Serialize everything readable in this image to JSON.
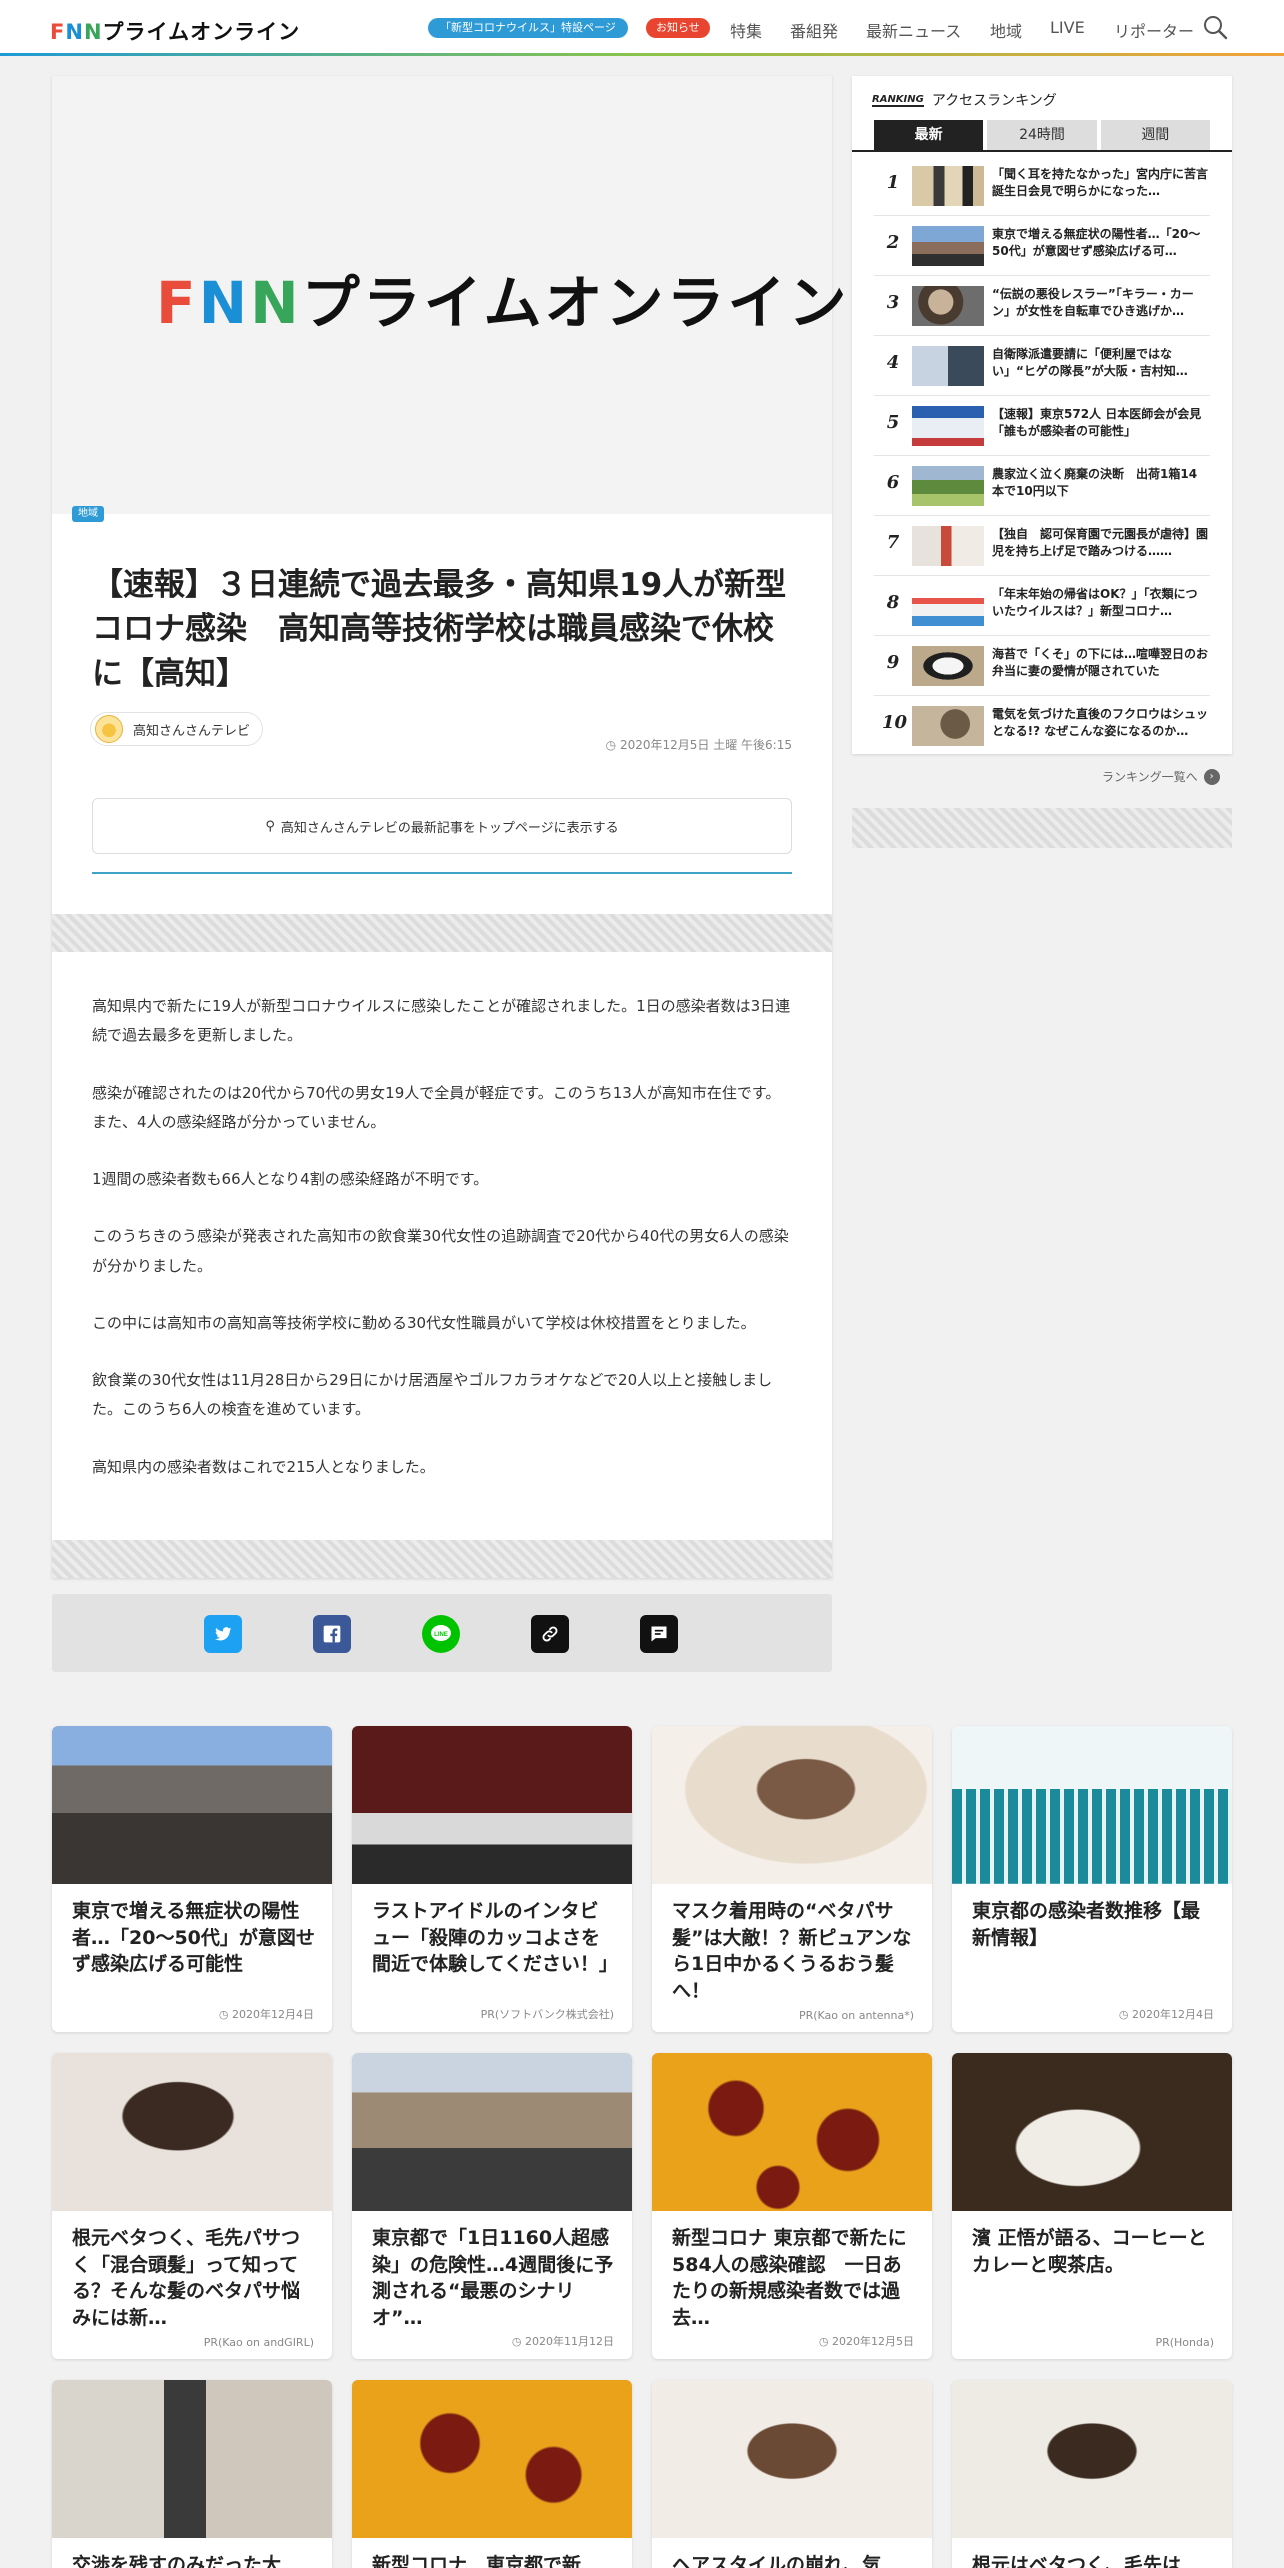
{
  "header": {
    "logo": "FNNプライムオンライン",
    "corona_pill": "「新型コロナウイルス」特設ページ",
    "notice_pill": "お知らせ",
    "nav": [
      "特集",
      "番組発",
      "最新ニュース",
      "地域",
      "LIVE",
      "リポーター"
    ]
  },
  "article": {
    "hero_logo": "FNNプライムオンライン",
    "category": "地域",
    "title": "【速報】３日連続で過去最多・高知県19人が新型コロナ感染　高知高等技術学校は職員感染で休校に【高知】",
    "source": "高知さんさんテレビ",
    "timestamp": "2020年12月5日 土曜 午後6:15",
    "follow_label": "高知さんさんテレビの最新記事をトップページに表示する",
    "paragraphs": [
      "高知県内で新たに19人が新型コロナウイルスに感染したことが確認されました。1日の感染者数は3日連続で過去最多を更新しました。",
      "感染が確認されたのは20代から70代の男女19人で全員が軽症です。このうち13人が高知市在住です。また、4人の感染経路が分かっていません。",
      "1週間の感染者数も66人となり4割の感染経路が不明です。",
      "このうちきのう感染が発表された高知市の飲食業30代女性の追跡調査で20代から40代の男女6人の感染が分かりました。",
      "この中には高知市の高知高等技術学校に勤める30代女性職員がいて学校は休校措置をとりました。",
      "飲食業の30代女性は11月28日から29日にかけ居酒屋やゴルフカラオケなどで20人以上と接触しました。このうち6人の検査を進めています。",
      "高知県内の感染者数はこれで215人となりました。"
    ]
  },
  "share": {
    "buttons": [
      {
        "name": "twitter",
        "color": "#1da1f2",
        "glyph": "t"
      },
      {
        "name": "facebook",
        "color": "#3b5998",
        "glyph": "f"
      },
      {
        "name": "line",
        "color": "#00c300",
        "glyph": "L"
      },
      {
        "name": "link",
        "color": "#111111",
        "glyph": "⚭"
      },
      {
        "name": "comment",
        "color": "#111111",
        "glyph": "≡"
      }
    ]
  },
  "ranking": {
    "tag": "RANKING",
    "title": "アクセスランキング",
    "tabs": [
      "最新",
      "24時間",
      "週間"
    ],
    "items": [
      {
        "rank": "1",
        "text": "「聞く耳を持たなかった」宮内庁に苦言　誕生日会見で明らかになった…"
      },
      {
        "rank": "2",
        "text": "東京で増える無症状の陽性者…「20～50代」が意図せず感染広げる可…"
      },
      {
        "rank": "3",
        "text": "“伝説の悪役レスラー”「キラー・カーン」が女性を自転車でひき逃げか…"
      },
      {
        "rank": "4",
        "text": "自衛隊派遣要請に「便利屋ではない」“ヒゲの隊長”が大阪・吉村知…"
      },
      {
        "rank": "5",
        "text": "【速報】東京572人 日本医師会が会見　「誰もが感染者の可能性」"
      },
      {
        "rank": "6",
        "text": "農家泣く泣く廃棄の決断　出荷1箱14本で10円以下"
      },
      {
        "rank": "7",
        "text": "【独自　認可保育園で元園長が虐待】園児を持ち上げ足で踏みつける……"
      },
      {
        "rank": "8",
        "text": "「年末年始の帰省はOK？」「衣類についたウイルスは？」新型コロナ…"
      },
      {
        "rank": "9",
        "text": "海苔で「くそ」の下には…喧嘩翌日のお弁当に妻の愛情が隠されていた"
      },
      {
        "rank": "10",
        "text": "電気を気づけた直後のフクロウはシュッとなる!? なぜこんな姿になるのか…"
      }
    ],
    "more_label": "ランキング一覧へ"
  },
  "cards": [
    {
      "title": "東京で増える無症状の陽性者…「20～50代」が意図せず感染広げる可能性",
      "meta": "2020年12月4日",
      "is_pr": false
    },
    {
      "title": "ラストアイドルのインタビュー「殺陣のカッコよさを間近で体験してください！」",
      "meta": "PR(ソフトバンク株式会社)",
      "is_pr": true
    },
    {
      "title": "マスク着用時の“ベタパサ髪”は大敵！？新ピュアンなら1日中かるくうるおう髪へ！",
      "meta": "PR(Kao on antenna*)",
      "is_pr": true
    },
    {
      "title": "東京都の感染者数推移【最新情報】",
      "meta": "2020年12月4日",
      "is_pr": false
    },
    {
      "title": "根元ベタつく、毛先パサつく「混合頭髪」って知ってる？そんな髪のベタパサ悩みには新…",
      "meta": "PR(Kao on andGIRL)",
      "is_pr": true
    },
    {
      "title": "東京都で「1日1160人超感染」の危険性…4週間後に予測される“最悪のシナリオ”…",
      "meta": "2020年11月12日",
      "is_pr": false
    },
    {
      "title": "新型コロナ 東京都で新たに584人の感染確認　一日あたりの新規感染者数では過去…",
      "meta": "2020年12月5日",
      "is_pr": false
    },
    {
      "title": "濱 正悟が語る、コーヒーとカレーと喫茶店。",
      "meta": "PR(Honda)",
      "is_pr": true
    },
    {
      "title": "交渉を残すのみだった大学…",
      "meta": "",
      "is_pr": false
    },
    {
      "title": "新型コロナ　東京都で新た…",
      "meta": "",
      "is_pr": false
    },
    {
      "title": "ヘアスタイルの崩れ、気に…",
      "meta": "",
      "is_pr": false
    },
    {
      "title": "根元はベタつく、毛先はパ…",
      "meta": "",
      "is_pr": false
    }
  ]
}
